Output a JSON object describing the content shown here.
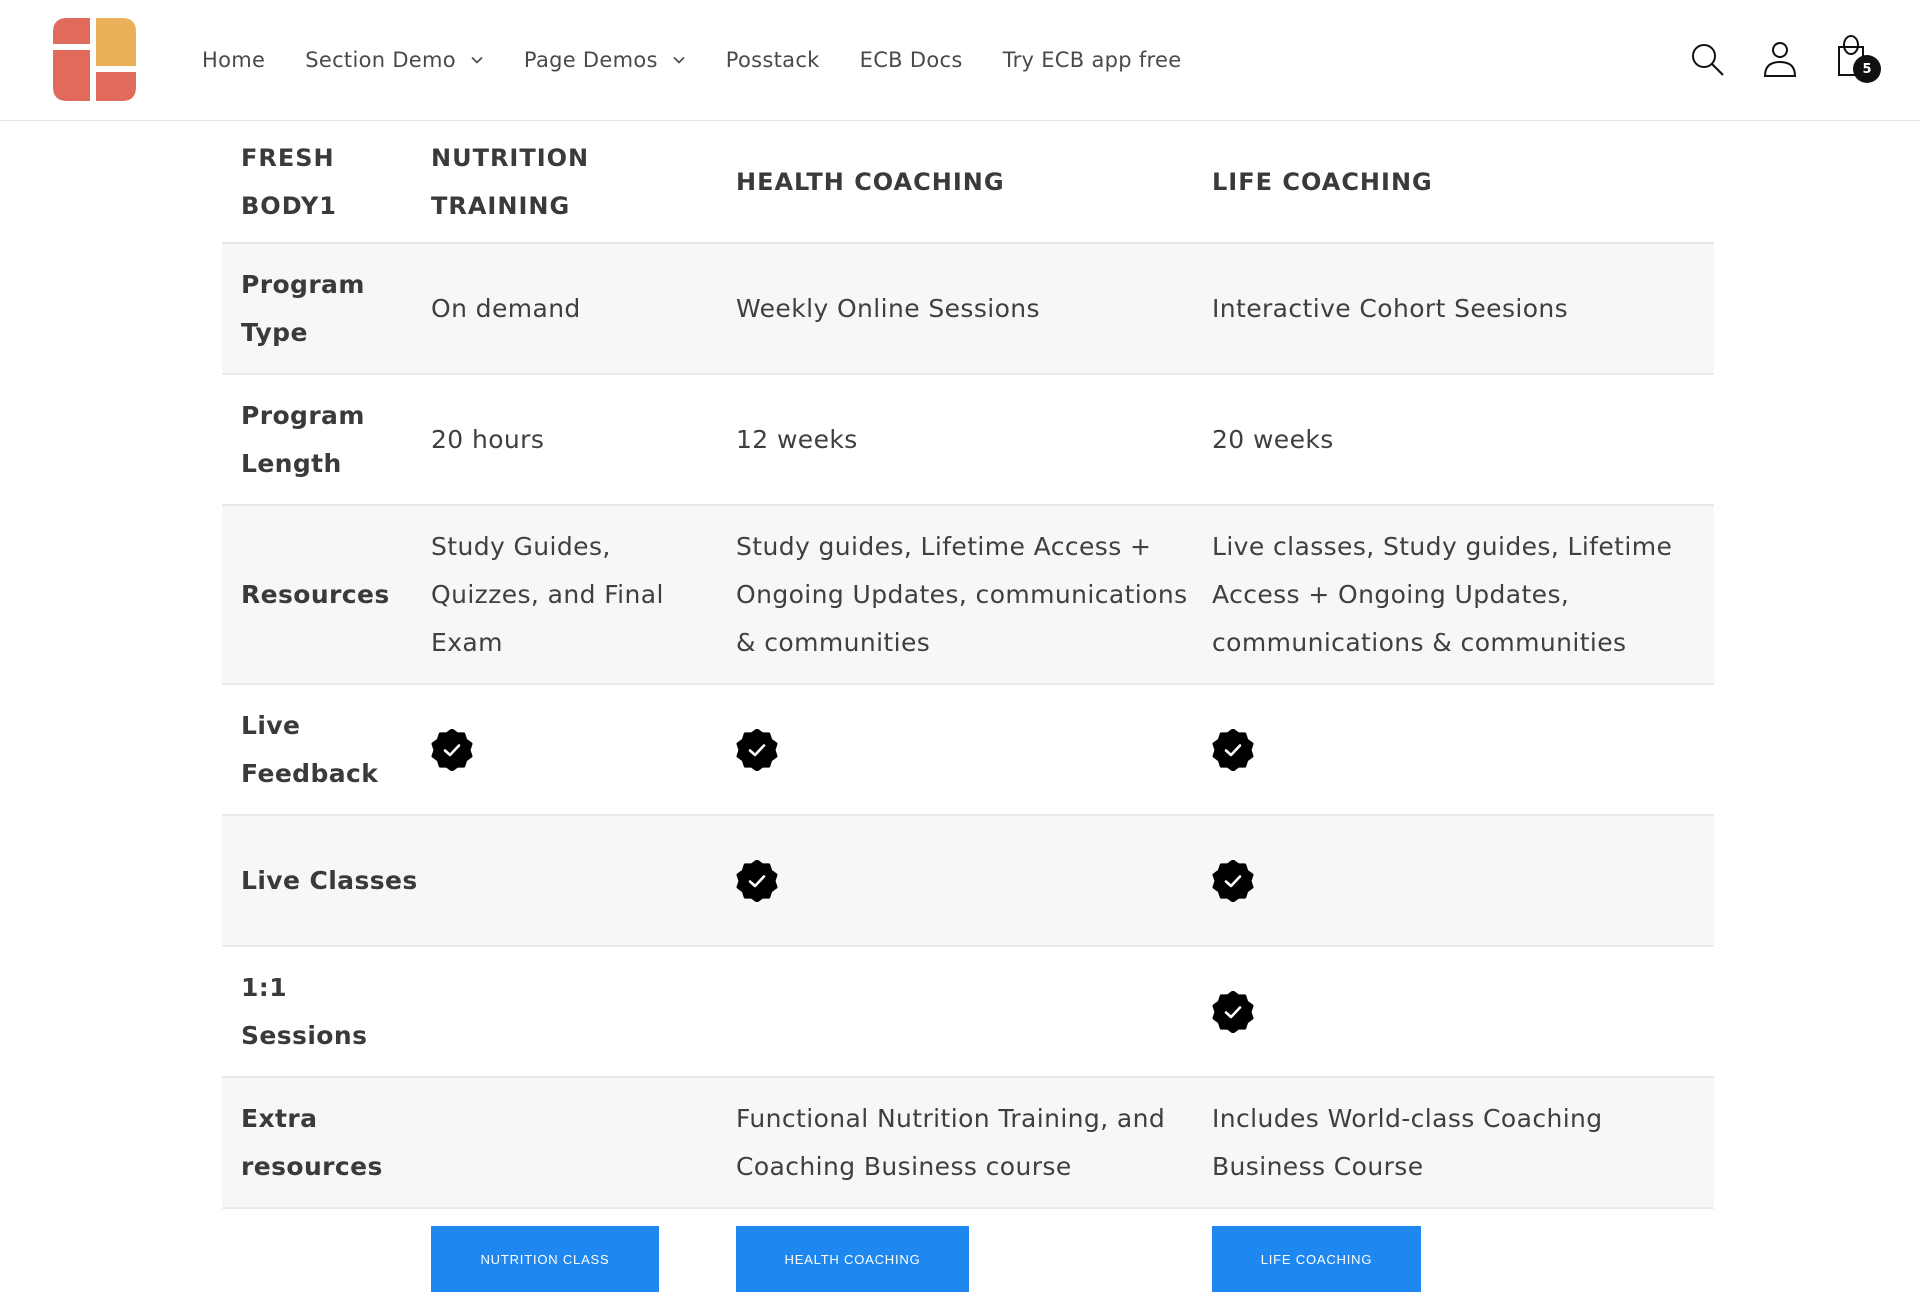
{
  "header": {
    "logo_colors": {
      "red": "#e06a5c",
      "yellow": "#e9b159"
    },
    "nav": [
      {
        "label": "Home",
        "has_dropdown": false
      },
      {
        "label": "Section Demo",
        "has_dropdown": true
      },
      {
        "label": "Page Demos",
        "has_dropdown": true
      },
      {
        "label": "Posstack",
        "has_dropdown": false
      },
      {
        "label": "ECB Docs",
        "has_dropdown": false
      },
      {
        "label": "Try ECB app free",
        "has_dropdown": false
      }
    ],
    "icons": [
      "search-icon",
      "account-icon",
      "cart-icon"
    ],
    "cart_count": "5"
  },
  "table": {
    "columns": [
      "FRESH BODY1",
      "NUTRITION TRAINING",
      "HEALTH COACHING",
      "LIFE COACHING"
    ],
    "rows": [
      {
        "label": "Program Type",
        "values": [
          "On demand",
          "Weekly Online Sessions",
          "Interactive Cohort Seesions"
        ]
      },
      {
        "label": "Program Length",
        "values": [
          "20 hours",
          "12 weeks",
          "20 weeks"
        ]
      },
      {
        "label": "Resources",
        "values": [
          "Study Guides, Quizzes, and Final Exam",
          "Study guides, Lifetime Access + Ongoing Updates, communications & communities",
          "Live classes, Study guides, Lifetime Access + Ongoing Updates, communications & communities"
        ]
      },
      {
        "label": "Live Feedback",
        "checks": [
          true,
          true,
          true
        ]
      },
      {
        "label": "Live Classes",
        "checks": [
          false,
          true,
          true
        ]
      },
      {
        "label": "1:1 Sessions",
        "checks": [
          false,
          false,
          true
        ]
      },
      {
        "label": "Extra resources",
        "values": [
          "",
          "Functional Nutrition Training, and Coaching Business course",
          "Includes World-class Coaching Business Course"
        ]
      }
    ]
  },
  "buttons": [
    {
      "label": "NUTRITION CLASS"
    },
    {
      "label": "HEALTH COACHING"
    },
    {
      "label": "LIFE COACHING"
    }
  ],
  "colors": {
    "button_blue": "#1f87f0",
    "check_black": "#000000",
    "row_alt": "#f7f7f7"
  }
}
